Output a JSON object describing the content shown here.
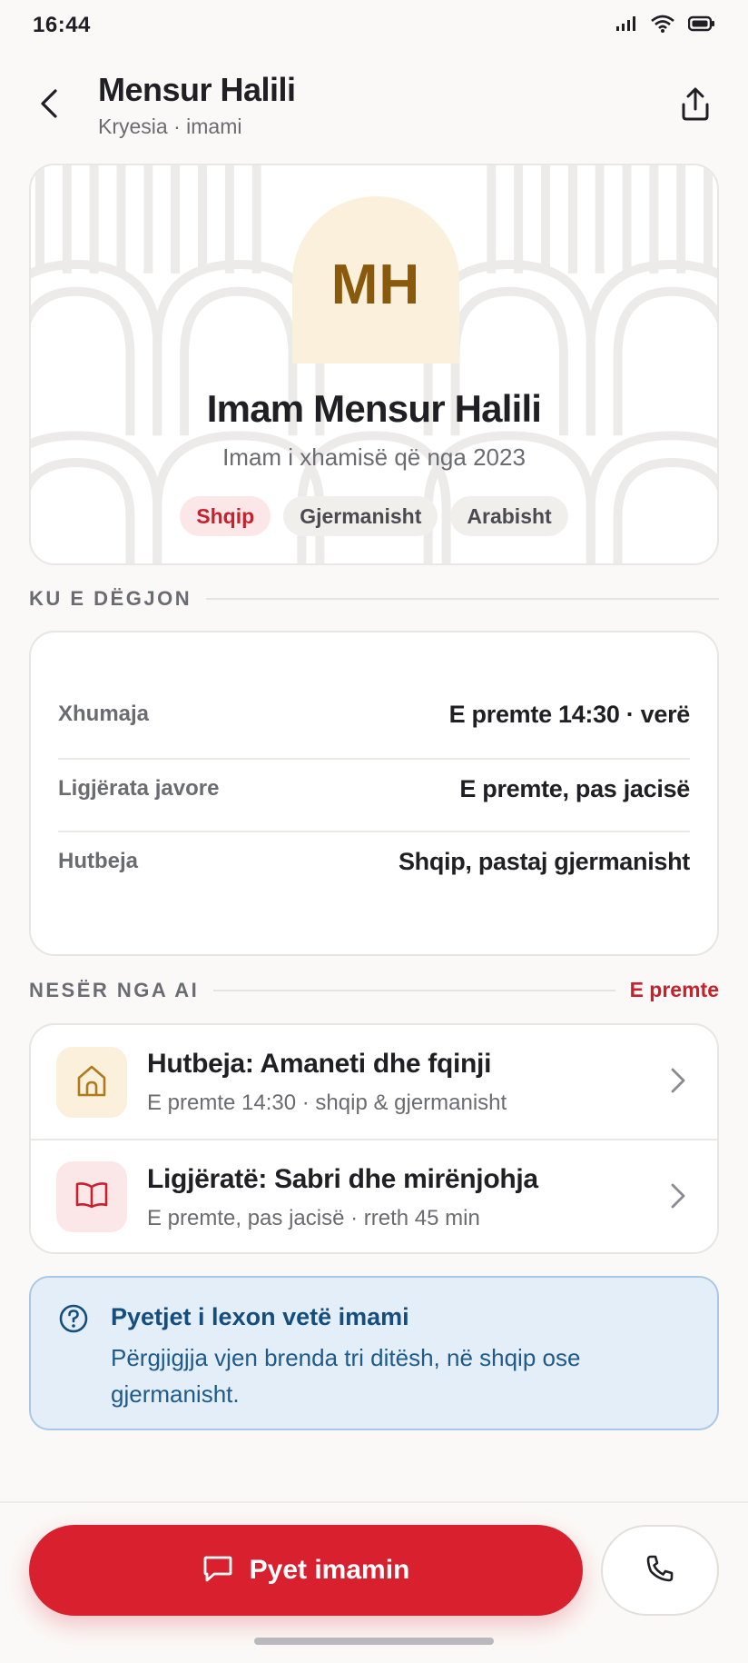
{
  "status_bar": {
    "time": "16:44",
    "icons": [
      "signal-icon",
      "wifi-icon",
      "battery-icon"
    ]
  },
  "header": {
    "title": "Mensur Halili",
    "subtitle": "Kryesia · imami",
    "back_icon": "chevron-left-icon",
    "share_icon": "share-icon"
  },
  "profile": {
    "initials": "MH",
    "name": "Imam Mensur Halili",
    "role": "Imam i xhamisë që nga 2023",
    "languages": [
      {
        "label": "Shqip",
        "active": true
      },
      {
        "label": "Gjermanisht",
        "active": false
      },
      {
        "label": "Arabisht",
        "active": false
      }
    ]
  },
  "where_section": {
    "title": "KU E DËGJON",
    "rows": [
      {
        "label": "Xhumaja",
        "value": "E premte 14:30 · verë"
      },
      {
        "label": "Ligjërata javore",
        "value": "E premte, pas jacisë"
      },
      {
        "label": "Hutbeja",
        "value": "Shqip, pastaj gjermanisht"
      }
    ]
  },
  "tomorrow_section": {
    "title": "NESËR NGA AI",
    "day_label": "E premte",
    "events": [
      {
        "title": "Hutbeja: Amaneti dhe fqinji",
        "meta": "E premte 14:30 · shqip & gjermanisht",
        "icon": "mosque-icon",
        "icon_bg": "#faf0dc",
        "icon_color": "#b07a1a"
      },
      {
        "title": "Ligjëratë: Sabri dhe mirënjohja",
        "meta": "E premte, pas jacisë · rreth 45 min",
        "icon": "book-icon",
        "icon_bg": "#fbe7e8",
        "icon_color": "#c8202d"
      }
    ]
  },
  "notice": {
    "icon": "question-circle-icon",
    "title": "Pyetjet i lexon vetë imami",
    "body": "Përgjigjja vjen brenda tri ditësh, në shqip ose gjermanisht."
  },
  "actions": {
    "primary_label": "Pyet imamin",
    "primary_icon": "chat-bubble-icon",
    "call_icon": "phone-icon"
  },
  "colors": {
    "accent": "#d9202e",
    "background": "#fbf9f7",
    "avatar_bg": "#faf0dc",
    "avatar_text": "#8a5a0c",
    "notice_bg": "#e3eef8",
    "notice_text": "#144e7e"
  }
}
